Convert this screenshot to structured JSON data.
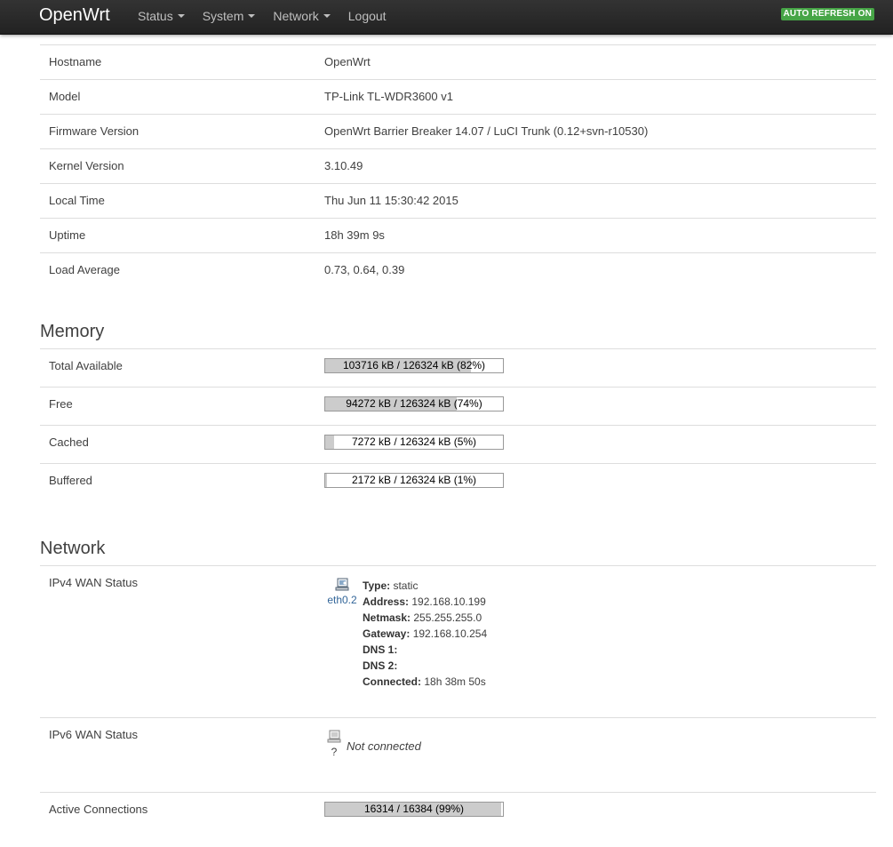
{
  "navbar": {
    "brand": "OpenWrt",
    "menu": [
      {
        "label": "Status"
      },
      {
        "label": "System"
      },
      {
        "label": "Network"
      },
      {
        "label": "Logout"
      }
    ],
    "refresh_badge": "AUTO REFRESH ON"
  },
  "system": {
    "rows": [
      {
        "label": "Hostname",
        "value": "OpenWrt"
      },
      {
        "label": "Model",
        "value": "TP-Link TL-WDR3600 v1"
      },
      {
        "label": "Firmware Version",
        "value": "OpenWrt Barrier Breaker 14.07 / LuCI Trunk (0.12+svn-r10530)"
      },
      {
        "label": "Kernel Version",
        "value": "3.10.49"
      },
      {
        "label": "Local Time",
        "value": "Thu Jun 11 15:30:42 2015"
      },
      {
        "label": "Uptime",
        "value": "18h 39m 9s"
      },
      {
        "label": "Load Average",
        "value": "0.73, 0.64, 0.39"
      }
    ]
  },
  "memory": {
    "title": "Memory",
    "rows": [
      {
        "label": "Total Available",
        "text": "103716 kB / 126324 kB (82%)",
        "fraction": 0.82
      },
      {
        "label": "Free",
        "text": "94272 kB / 126324 kB (74%)",
        "fraction": 0.74
      },
      {
        "label": "Cached",
        "text": "7272 kB / 126324 kB (5%)",
        "fraction": 0.05
      },
      {
        "label": "Buffered",
        "text": "2172 kB / 126324 kB (1%)",
        "fraction": 0.01
      }
    ]
  },
  "network": {
    "title": "Network",
    "ipv4": {
      "label": "IPv4 WAN Status",
      "iface": "eth0.2",
      "fields": [
        {
          "k": "Type:",
          "v": "static"
        },
        {
          "k": "Address:",
          "v": "192.168.10.199"
        },
        {
          "k": "Netmask:",
          "v": "255.255.255.0"
        },
        {
          "k": "Gateway:",
          "v": "192.168.10.254"
        },
        {
          "k": "DNS 1:",
          "v": ""
        },
        {
          "k": "DNS 2:",
          "v": ""
        },
        {
          "k": "Connected:",
          "v": "18h 38m 50s"
        }
      ]
    },
    "ipv6": {
      "label": "IPv6 WAN Status",
      "iface": "?",
      "status": "Not connected"
    },
    "active": {
      "label": "Active Connections",
      "text": "16314 / 16384 (99%)",
      "fraction": 0.99
    }
  }
}
